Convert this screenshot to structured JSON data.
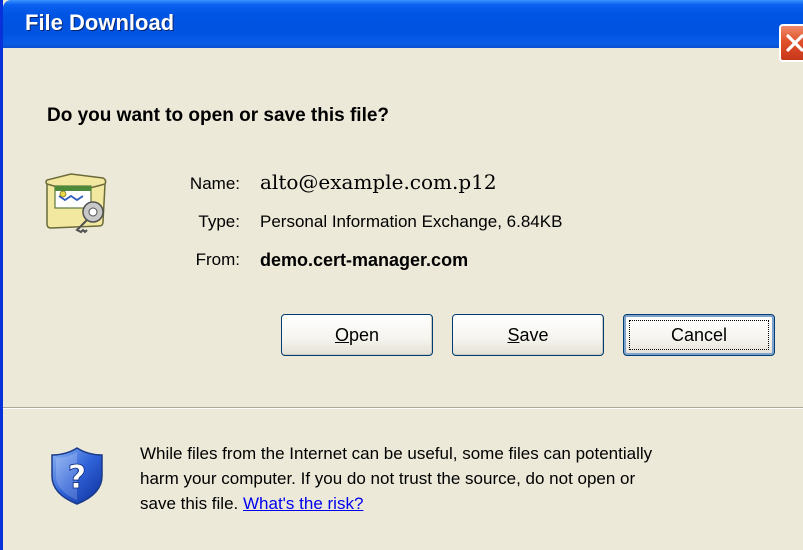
{
  "window": {
    "title": "File Download"
  },
  "dialog": {
    "question": "Do you want to open or save this file?",
    "name_label": "Name:",
    "name_value": "alto@example.com.p12",
    "type_label": "Type:",
    "type_value": "Personal Information Exchange, 6.84KB",
    "from_label": "From:",
    "from_value": "demo.cert-manager.com"
  },
  "buttons": {
    "open_label_mnemonic": "O",
    "open_label_rest": "pen",
    "save_label_mnemonic": "S",
    "save_label_rest": "ave",
    "cancel_label": "Cancel"
  },
  "warning": {
    "line1": "While files from the Internet can be useful, some files can potentially",
    "line2": "harm your computer. If you do not trust the source, do not open or",
    "line3_prefix": "save this file. ",
    "risk_link": "What's the risk?"
  },
  "icons": {
    "file": "certificate-file-icon",
    "shield": "security-shield-question-icon",
    "close": "close-icon"
  },
  "colors": {
    "titlebar": "#0054e3",
    "dialog_bg": "#ece9d8",
    "close_button": "#e0512a",
    "link": "#0000ee"
  }
}
